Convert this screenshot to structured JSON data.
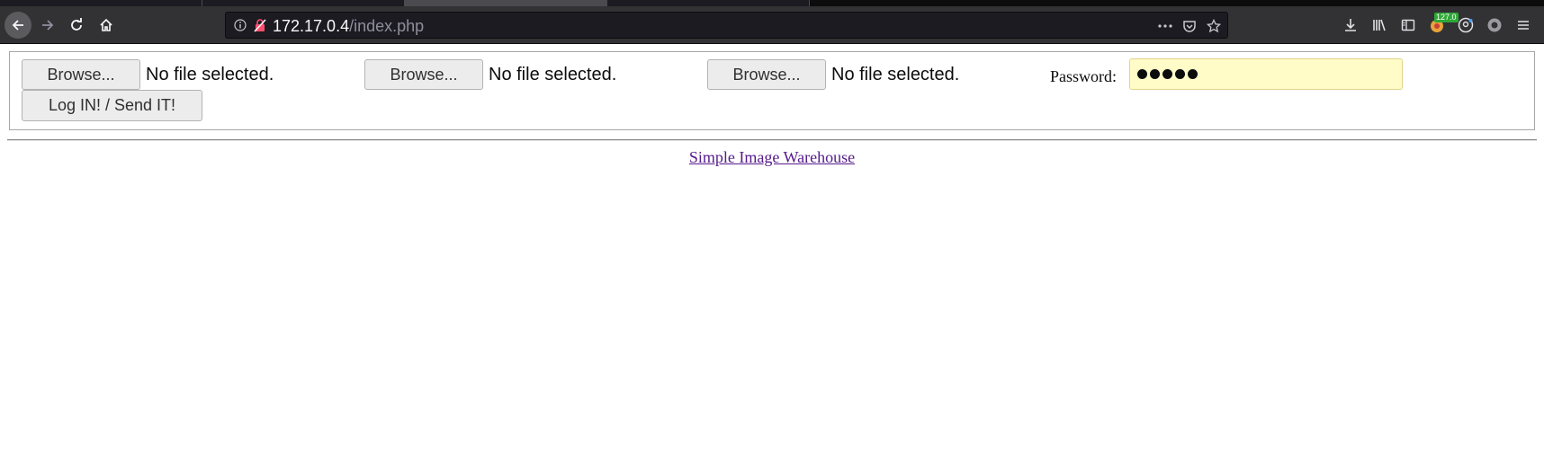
{
  "browser": {
    "url": {
      "host": "172.17.0.4",
      "path": "/index.php"
    },
    "container_badge": "127.0"
  },
  "form": {
    "file_inputs": [
      {
        "button_label": "Browse...",
        "status": "No file selected."
      },
      {
        "button_label": "Browse...",
        "status": "No file selected."
      },
      {
        "button_label": "Browse...",
        "status": "No file selected."
      }
    ],
    "password": {
      "label": "Password:",
      "masked_length": 5
    },
    "submit_label": "Log IN! / Send IT!"
  },
  "footer": {
    "link_text": "Simple Image Warehouse"
  },
  "icons": {
    "nav": [
      "back-arrow-icon",
      "forward-arrow-icon",
      "reload-icon",
      "home-icon"
    ],
    "urlbar": [
      "info-icon",
      "insecure-lock-icon",
      "page-actions-icon",
      "pocket-icon",
      "bookmark-star-icon"
    ],
    "toolbar": [
      "downloads-icon",
      "library-icon",
      "sidebar-icon",
      "container-extension-icon",
      "account-icon",
      "extension-circle-icon",
      "menu-icon"
    ]
  },
  "colors": {
    "chrome_bg": "#323234",
    "password_field_bg": "#fffcc8",
    "link_color": "#551a8b"
  }
}
